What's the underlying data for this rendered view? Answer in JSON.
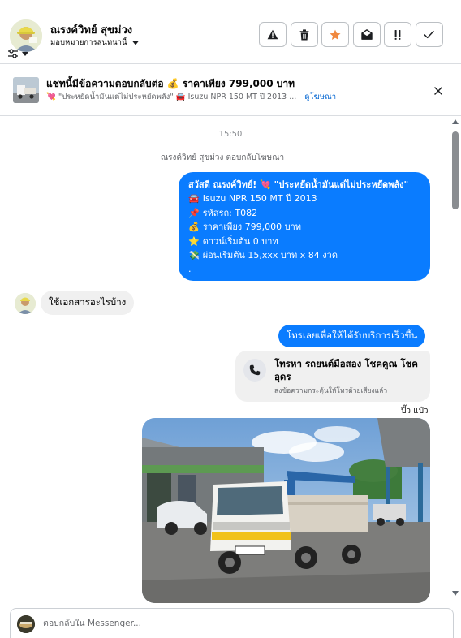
{
  "header": {
    "contact_name": "ณรงค์วิทย์ สุขม่วง",
    "assignee_label": "มอบหมายการสนทนานี้",
    "actions": [
      {
        "name": "report-button",
        "icon": "warning-icon"
      },
      {
        "name": "delete-button",
        "icon": "trash-icon"
      },
      {
        "name": "star-button",
        "icon": "star-icon"
      },
      {
        "name": "mark-unread-button",
        "icon": "envelope-open-icon"
      },
      {
        "name": "mark-followup-button",
        "icon": "follow-up-icon"
      },
      {
        "name": "mark-done-button",
        "icon": "check-icon"
      }
    ]
  },
  "ad_banner": {
    "title": "แชทนี้มีข้อความตอบกลับต่อ 💰 ราคาเพียง 799,000 บาท",
    "subtitle": "💘 \"ประหยัดน้ำมันแต่ไม่ประหยัดพลัง\" 🚘 Isuzu NPR 150 MT ปี 2013 ...",
    "view_ad_link": "ดูโฆษณา"
  },
  "conversation": {
    "timestamp": "15:50",
    "reply_note": "ณรงค์วิทย์ สุขม่วง ตอบกลับโฆษณา",
    "outgoing_ad_message": {
      "lines": [
        {
          "emoji": "",
          "text": "สวัสดี ณรงค์วิทย์! 💘 \"ประหยัดน้ำมันแต่ไม่ประหยัดพลัง\""
        },
        {
          "emoji": "🚘",
          "text": "Isuzu NPR 150 MT ปี 2013"
        },
        {
          "emoji": "📌",
          "text": "รหัสรถ: T082"
        },
        {
          "emoji": "💰",
          "text": "ราคาเพียง 799,000 บาท"
        },
        {
          "emoji": "⭐",
          "text": "ดาวน์เริ่มต้น 0 บาท"
        },
        {
          "emoji": "💸",
          "text": "ผ่อนเริ่มต้น 15,xxx บาท x 84 งวด"
        },
        {
          "emoji": "",
          "text": "."
        }
      ]
    },
    "incoming_message": "ใช้เอกสารอะไรบ้าง",
    "outgoing_message_2": "โทรเลยเพื่อให้ได้รับบริการเร็วขึ้น",
    "call_card": {
      "title": "โทรหา รถยนต์มือสอง โชคคูณ โชค อุดร",
      "subtitle": "ส่งข้อความกระตุ้นให้โทรด้วยเสียงแล้ว"
    },
    "seen_label": "ปิ๊ว แป๋ว"
  },
  "composer": {
    "placeholder": "ตอบกลับใน Messenger..."
  },
  "colors": {
    "outgoing_bubble": "#0a7cff",
    "incoming_bubble": "#f0f0f0",
    "link": "#0064d1",
    "star_accent": "#f0883e"
  }
}
